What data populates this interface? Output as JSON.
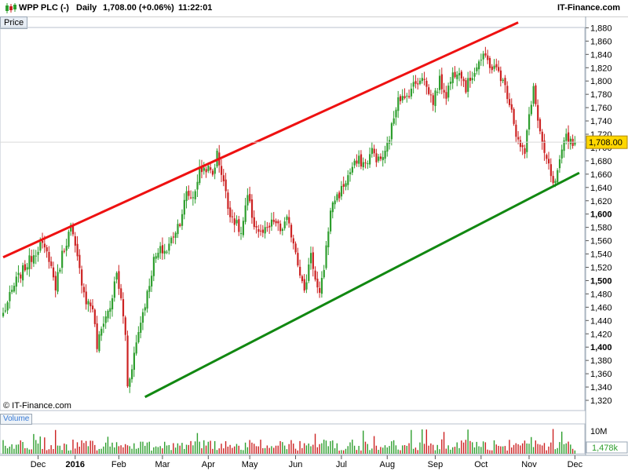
{
  "header": {
    "instrument": "WPP PLC (-)",
    "period": "Daily",
    "price": "1,708.00 (+0.06%)",
    "time": "11:22:01",
    "brand": "IT-Finance.com"
  },
  "panels": {
    "price_tab": "Price",
    "volume_tab": "Volume",
    "copyright": "© IT-Finance.com"
  },
  "colors": {
    "up_candle": "#2e9e2e",
    "down_candle": "#cc2222",
    "resistance": "#ee1111",
    "support": "#118811",
    "last_price_bg": "#ffd700"
  },
  "chart_data": [
    {
      "type": "candlestick",
      "title": "WPP PLC (-)",
      "xlabel": "",
      "ylabel": "Price",
      "ylim": [
        1310,
        1900
      ],
      "y_ticks": [
        1320,
        1340,
        1360,
        1380,
        1400,
        1420,
        1440,
        1460,
        1480,
        1500,
        1520,
        1540,
        1560,
        1580,
        1600,
        1620,
        1640,
        1660,
        1680,
        1700,
        1720,
        1740,
        1760,
        1780,
        1800,
        1820,
        1840,
        1860,
        1880
      ],
      "y_tick_labels": [
        "1,320",
        "1,340",
        "1,360",
        "1,380",
        "1,400",
        "1,420",
        "1,440",
        "1,460",
        "1,480",
        "1,500",
        "1,520",
        "1,540",
        "1,560",
        "1,580",
        "1,600",
        "1,620",
        "1,640",
        "1,660",
        "1,680",
        "1,700",
        "1,720",
        "1,740",
        "1,760",
        "1,780",
        "1,800",
        "1,820",
        "1,840",
        "1,860",
        "1,880"
      ],
      "bold_ticks": [
        1400,
        1500,
        1600
      ],
      "x_ticks": [
        {
          "label": "Dec",
          "bar": 16
        },
        {
          "label": "2016",
          "bar": 33
        },
        {
          "label": "Feb",
          "bar": 53
        },
        {
          "label": "Mar",
          "bar": 73
        },
        {
          "label": "Apr",
          "bar": 94
        },
        {
          "label": "May",
          "bar": 113
        },
        {
          "label": "Jun",
          "bar": 134
        },
        {
          "label": "Jul",
          "bar": 155
        },
        {
          "label": "Aug",
          "bar": 176
        },
        {
          "label": "Sep",
          "bar": 198
        },
        {
          "label": "Oct",
          "bar": 219
        },
        {
          "label": "Nov",
          "bar": 241
        },
        {
          "label": "Dec",
          "bar": 262
        }
      ],
      "last_price": 1708,
      "last_price_label": "1,708.00",
      "trend_lines": [
        {
          "name": "resistance",
          "from": {
            "bar": 0,
            "value": 1535
          },
          "to": {
            "bar": 236,
            "value": 1888
          }
        },
        {
          "name": "support",
          "from": {
            "bar": 65,
            "value": 1325
          },
          "to": {
            "bar": 264,
            "value": 1662
          }
        }
      ],
      "anchors": [
        [
          0,
          1450
        ],
        [
          6,
          1500
        ],
        [
          12,
          1530
        ],
        [
          17,
          1555
        ],
        [
          21,
          1535
        ],
        [
          24,
          1490
        ],
        [
          27,
          1540
        ],
        [
          31,
          1580
        ],
        [
          35,
          1515
        ],
        [
          38,
          1470
        ],
        [
          41,
          1460
        ],
        [
          43,
          1400
        ],
        [
          46,
          1440
        ],
        [
          49,
          1460
        ],
        [
          52,
          1510
        ],
        [
          54,
          1470
        ],
        [
          56,
          1420
        ],
        [
          57,
          1340
        ],
        [
          60,
          1390
        ],
        [
          63,
          1440
        ],
        [
          66,
          1480
        ],
        [
          69,
          1530
        ],
        [
          72,
          1545
        ],
        [
          75,
          1545
        ],
        [
          78,
          1570
        ],
        [
          81,
          1590
        ],
        [
          84,
          1630
        ],
        [
          87,
          1625
        ],
        [
          90,
          1665
        ],
        [
          93,
          1670
        ],
        [
          96,
          1660
        ],
        [
          98,
          1690
        ],
        [
          101,
          1650
        ],
        [
          103,
          1610
        ],
        [
          106,
          1590
        ],
        [
          109,
          1570
        ],
        [
          112,
          1625
        ],
        [
          115,
          1585
        ],
        [
          118,
          1570
        ],
        [
          121,
          1575
        ],
        [
          124,
          1590
        ],
        [
          127,
          1575
        ],
        [
          130,
          1590
        ],
        [
          133,
          1560
        ],
        [
          135,
          1530
        ],
        [
          138,
          1480
        ],
        [
          141,
          1545
        ],
        [
          143,
          1500
        ],
        [
          145,
          1475
        ],
        [
          147,
          1520
        ],
        [
          149,
          1580
        ],
        [
          151,
          1620
        ],
        [
          154,
          1630
        ],
        [
          157,
          1650
        ],
        [
          160,
          1670
        ],
        [
          163,
          1680
        ],
        [
          166,
          1675
        ],
        [
          169,
          1695
        ],
        [
          172,
          1680
        ],
        [
          175,
          1690
        ],
        [
          178,
          1730
        ],
        [
          181,
          1780
        ],
        [
          184,
          1770
        ],
        [
          187,
          1790
        ],
        [
          190,
          1800
        ],
        [
          192,
          1810
        ],
        [
          194,
          1790
        ],
        [
          197,
          1770
        ],
        [
          200,
          1800
        ],
        [
          203,
          1780
        ],
        [
          206,
          1810
        ],
        [
          209,
          1820
        ],
        [
          212,
          1790
        ],
        [
          215,
          1810
        ],
        [
          218,
          1830
        ],
        [
          221,
          1835
        ],
        [
          224,
          1820
        ],
        [
          227,
          1815
        ],
        [
          230,
          1790
        ],
        [
          233,
          1760
        ],
        [
          235,
          1720
        ],
        [
          237,
          1700
        ],
        [
          239,
          1690
        ],
        [
          241,
          1750
        ],
        [
          243,
          1790
        ],
        [
          245,
          1740
        ],
        [
          247,
          1700
        ],
        [
          249,
          1680
        ],
        [
          251,
          1660
        ],
        [
          252,
          1640
        ],
        [
          254,
          1660
        ],
        [
          256,
          1690
        ],
        [
          258,
          1720
        ],
        [
          260,
          1710
        ],
        [
          262,
          1708
        ]
      ],
      "volume": {
        "label": "Volume",
        "tick_labels": [
          "10M",
          "1,478k"
        ]
      }
    }
  ]
}
